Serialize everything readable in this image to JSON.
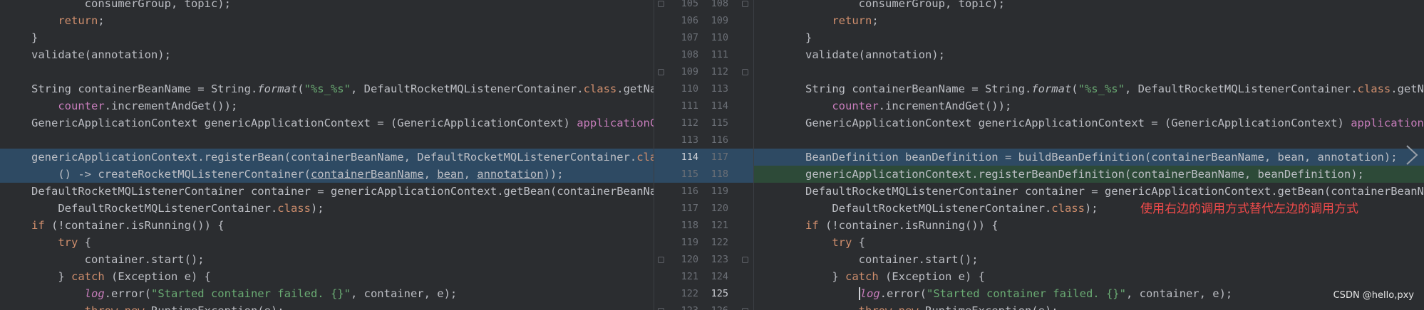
{
  "colors": {
    "background": "#2b2d30",
    "modified_bg": "#2e4a63",
    "added_bg": "#2d4a38",
    "keyword": "#cf8e6d",
    "string": "#6aab73",
    "field": "#c77dbb",
    "annotation_text": "#f04a4a"
  },
  "left": {
    "lines": [
      [
        {
          "t": "        consumerGroup, topic);"
        }
      ],
      [
        {
          "t": "    "
        },
        {
          "t": "return",
          "k": "kw"
        },
        {
          "t": ";"
        }
      ],
      [
        {
          "t": "}"
        }
      ],
      [
        {
          "t": "validate(annotation);"
        }
      ],
      [
        {
          "t": ""
        }
      ],
      [
        {
          "t": "String containerBeanName = String."
        },
        {
          "t": "format",
          "k": "ital"
        },
        {
          "t": "("
        },
        {
          "t": "\"%s_%s\"",
          "k": "str"
        },
        {
          "t": ", DefaultRocketMQListenerContainer."
        },
        {
          "t": "class",
          "k": "kw"
        },
        {
          "t": ".getName(),"
        }
      ],
      [
        {
          "t": "    "
        },
        {
          "t": "counter",
          "k": "fld"
        },
        {
          "t": ".incrementAndGet());"
        }
      ],
      [
        {
          "t": "GenericApplicationContext genericApplicationContext = (GenericApplicationContext) "
        },
        {
          "t": "applicationContext",
          "k": "fld"
        },
        {
          "t": ";"
        }
      ],
      [
        {
          "t": ""
        }
      ],
      [
        {
          "t": "genericApplicationContext.registerBean(containerBeanName, DefaultRocketMQListenerContainer."
        },
        {
          "t": "class",
          "k": "kw"
        },
        {
          "t": ","
        }
      ],
      [
        {
          "t": "    () -> createRocketMQListenerContainer("
        },
        {
          "t": "containerBeanName",
          "k": "par"
        },
        {
          "t": ", "
        },
        {
          "t": "bean",
          "k": "par"
        },
        {
          "t": ", "
        },
        {
          "t": "annotation",
          "k": "par"
        },
        {
          "t": "));"
        }
      ],
      [
        {
          "t": "DefaultRocketMQListenerContainer container = genericApplicationContext.getBean(containerBeanName,"
        }
      ],
      [
        {
          "t": "    DefaultRocketMQListenerContainer."
        },
        {
          "t": "class",
          "k": "kw"
        },
        {
          "t": ");"
        }
      ],
      [
        {
          "t": "if",
          "k": "kw"
        },
        {
          "t": " (!container.isRunning()) {"
        }
      ],
      [
        {
          "t": "    "
        },
        {
          "t": "try",
          "k": "kw"
        },
        {
          "t": " {"
        }
      ],
      [
        {
          "t": "        container.start();"
        }
      ],
      [
        {
          "t": "    } "
        },
        {
          "t": "catch",
          "k": "kw"
        },
        {
          "t": " (Exception e) {"
        }
      ],
      [
        {
          "t": "        "
        },
        {
          "t": "log",
          "k": "logv"
        },
        {
          "t": ".error("
        },
        {
          "t": "\"Started container failed. {}\"",
          "k": "str"
        },
        {
          "t": ", container, e);"
        }
      ],
      [
        {
          "t": "        "
        },
        {
          "t": "throw new",
          "k": "kw"
        },
        {
          "t": " RuntimeException(e);"
        }
      ]
    ]
  },
  "right": {
    "lines": [
      [
        {
          "t": "        consumerGroup, topic);"
        }
      ],
      [
        {
          "t": "    "
        },
        {
          "t": "return",
          "k": "kw"
        },
        {
          "t": ";"
        }
      ],
      [
        {
          "t": "}"
        }
      ],
      [
        {
          "t": "validate(annotation);"
        }
      ],
      [
        {
          "t": ""
        }
      ],
      [
        {
          "t": "String containerBeanName = String."
        },
        {
          "t": "format",
          "k": "ital"
        },
        {
          "t": "("
        },
        {
          "t": "\"%s_%s\"",
          "k": "str"
        },
        {
          "t": ", DefaultRocketMQListenerContainer."
        },
        {
          "t": "class",
          "k": "kw"
        },
        {
          "t": ".getName(),"
        }
      ],
      [
        {
          "t": "    "
        },
        {
          "t": "counter",
          "k": "fld"
        },
        {
          "t": ".incrementAndGet());"
        }
      ],
      [
        {
          "t": "GenericApplicationContext genericApplicationContext = (GenericApplicationContext) "
        },
        {
          "t": "applicationContext",
          "k": "fld"
        },
        {
          "t": ";"
        }
      ],
      [
        {
          "t": ""
        }
      ],
      [
        {
          "t": "BeanDefinition beanDefinition = buildBeanDefinition(containerBeanName, bean, annotation);"
        }
      ],
      [
        {
          "t": "genericApplicationContext.registerBeanDefinition(containerBeanName, beanDefinition);"
        }
      ],
      [
        {
          "t": "DefaultRocketMQListenerContainer container = genericApplicationContext.getBean(containerBeanName,"
        }
      ],
      [
        {
          "t": "    DefaultRocketMQListenerContainer."
        },
        {
          "t": "class",
          "k": "kw"
        },
        {
          "t": ");"
        }
      ],
      [
        {
          "t": "if",
          "k": "kw"
        },
        {
          "t": " (!container.isRunning()) {"
        }
      ],
      [
        {
          "t": "    "
        },
        {
          "t": "try",
          "k": "kw"
        },
        {
          "t": " {"
        }
      ],
      [
        {
          "t": "        container.start();"
        }
      ],
      [
        {
          "t": "    } "
        },
        {
          "t": "catch",
          "k": "kw"
        },
        {
          "t": " (Exception e) {"
        }
      ],
      [
        {
          "t": "        "
        },
        {
          "t": "log",
          "k": "logv"
        },
        {
          "t": ".error("
        },
        {
          "t": "\"Started container failed. {}\"",
          "k": "str"
        },
        {
          "t": ", container, e);"
        }
      ],
      [
        {
          "t": "        "
        },
        {
          "t": "throw new",
          "k": "kw"
        },
        {
          "t": " RuntimeException(e);"
        }
      ]
    ]
  },
  "gutter": {
    "left_numbers": [
      "105",
      "106",
      "107",
      "108",
      "109",
      "110",
      "111",
      "112",
      "113",
      "114",
      "115",
      "116",
      "117",
      "118",
      "119",
      "120",
      "121",
      "122",
      "123"
    ],
    "right_numbers": [
      "108",
      "109",
      "110",
      "111",
      "112",
      "113",
      "114",
      "115",
      "116",
      "117",
      "118",
      "119",
      "120",
      "121",
      "122",
      "123",
      "124",
      "125",
      "126"
    ]
  },
  "annotation": {
    "text": "使用右边的调用方式替代左边的调用方式"
  },
  "watermark": {
    "text": "CSDN @hello,pxy"
  },
  "icons": {
    "next_diff": "chevron-right-icon"
  }
}
